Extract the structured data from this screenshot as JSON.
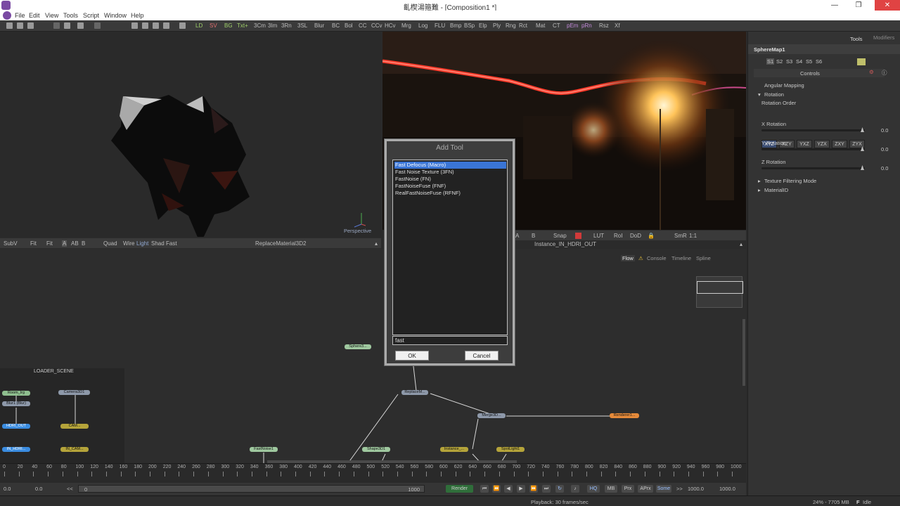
{
  "window": {
    "title": "齓楔湯箍難 - [Composition1 *]",
    "min": "—",
    "max": "❐",
    "close": "✕"
  },
  "menu": [
    "File",
    "Edit",
    "View",
    "Tools",
    "Script",
    "Window",
    "Help"
  ],
  "toolbar": [
    "LD",
    "SV",
    "BG",
    "Txt+",
    "3Cm",
    "3Im",
    "3Rn",
    "3SL",
    "Blur",
    "BC",
    "Bol",
    "CC",
    "CCv",
    "HCv",
    "Mrg",
    "Log",
    "FLU",
    "Bmp",
    "BSp",
    "Elp",
    "Ply",
    "Rng",
    "Rct",
    "Mat",
    "CT",
    "pEm",
    "pRn",
    "Rsz",
    "Xf"
  ],
  "viewer_left": {
    "perspective": "Perspective",
    "bar": [
      "SubV",
      "Fit",
      "Fit",
      "A",
      "AB",
      "B",
      "Quad",
      "Wire",
      "Light",
      "Shad",
      "Fast"
    ],
    "title": "ReplaceMaterial3D2"
  },
  "viewer_right": {
    "bar": [
      "A",
      "B",
      "Snap",
      "LUT",
      "RoI",
      "DoD",
      "SmR",
      "1:1"
    ],
    "title": "Instance_IN_HDRI_OUT"
  },
  "right_panel": {
    "tabs": [
      "Tools",
      "Modifiers"
    ],
    "tool_name": "SphereMap1",
    "slots": [
      "S1",
      "S2",
      "S3",
      "S4",
      "S5",
      "S6"
    ],
    "controls_label": "Controls",
    "angular_mapping": "Angular Mapping",
    "rotation": "Rotation",
    "rotation_order": "Rotation Order",
    "orders": [
      "XYZ",
      "XZY",
      "YXZ",
      "YZX",
      "ZXY",
      "ZYX"
    ],
    "x_rotation": "X Rotation",
    "x_value": "0.0",
    "y_rotation": "Y Rotation",
    "y_value": "0.0",
    "z_rotation": "Z Rotation",
    "z_value": "0.0",
    "texture_filtering": "Texture Filtering Mode",
    "material_id": "MaterialID"
  },
  "flow": {
    "tabs": [
      "Flow",
      "Console",
      "Timeline",
      "Spline"
    ],
    "group_label": "LOADER_SCENE",
    "nodes": [
      "Room_Irg",
      "Camera3D1",
      "Blur1 (Blur)",
      "HDRI_OUT",
      "CAM...",
      "IN_HDRI...",
      "IN_CAM...",
      "FastNoise1",
      "Shape3D1",
      "Instance_...",
      "SpotLight1",
      "ReplaceM...",
      "Merge3D...",
      "Renderer1...",
      "Sphere3..."
    ]
  },
  "ruler": {
    "ticks": [
      "0",
      "20",
      "40",
      "60",
      "80",
      "100",
      "120",
      "140",
      "160",
      "180",
      "200",
      "220",
      "240",
      "260",
      "280",
      "300",
      "320",
      "340",
      "360",
      "380",
      "400",
      "420",
      "440",
      "460",
      "480",
      "500",
      "520",
      "540",
      "560",
      "580",
      "600",
      "620",
      "640",
      "660",
      "680",
      "700",
      "720",
      "740",
      "760",
      "780",
      "800",
      "820",
      "840",
      "860",
      "880",
      "900",
      "920",
      "940",
      "960",
      "980",
      "1000"
    ]
  },
  "controls": {
    "start": "0.0",
    "current": "0.0",
    "rewind": "<<",
    "range_start": "0",
    "range_end": "1000",
    "render": "Render",
    "hq": "HQ",
    "mb": "MB",
    "prx": "Prx",
    "aprx": "APrx",
    "some": "Some",
    "ff": ">>",
    "end1": "1000.0",
    "end2": "1000.0"
  },
  "status": {
    "playback": "Playback: 30 frames/sec",
    "memory": "24% - 7705 MB",
    "state": "Idle"
  },
  "dialog": {
    "title": "Add Tool",
    "items": [
      "Fast Defocus (Macro)",
      "Fast Noise Texture (3FN)",
      "FastNoise (FN)",
      "FastNoiseFuse (FNF)",
      "RealFastNoiseFuse (RFNF)"
    ],
    "input": "fast",
    "ok": "OK",
    "cancel": "Cancel"
  },
  "colors": {
    "accent": "#3a75d6",
    "panel": "#333333",
    "render_button": "#2f6e3a"
  }
}
